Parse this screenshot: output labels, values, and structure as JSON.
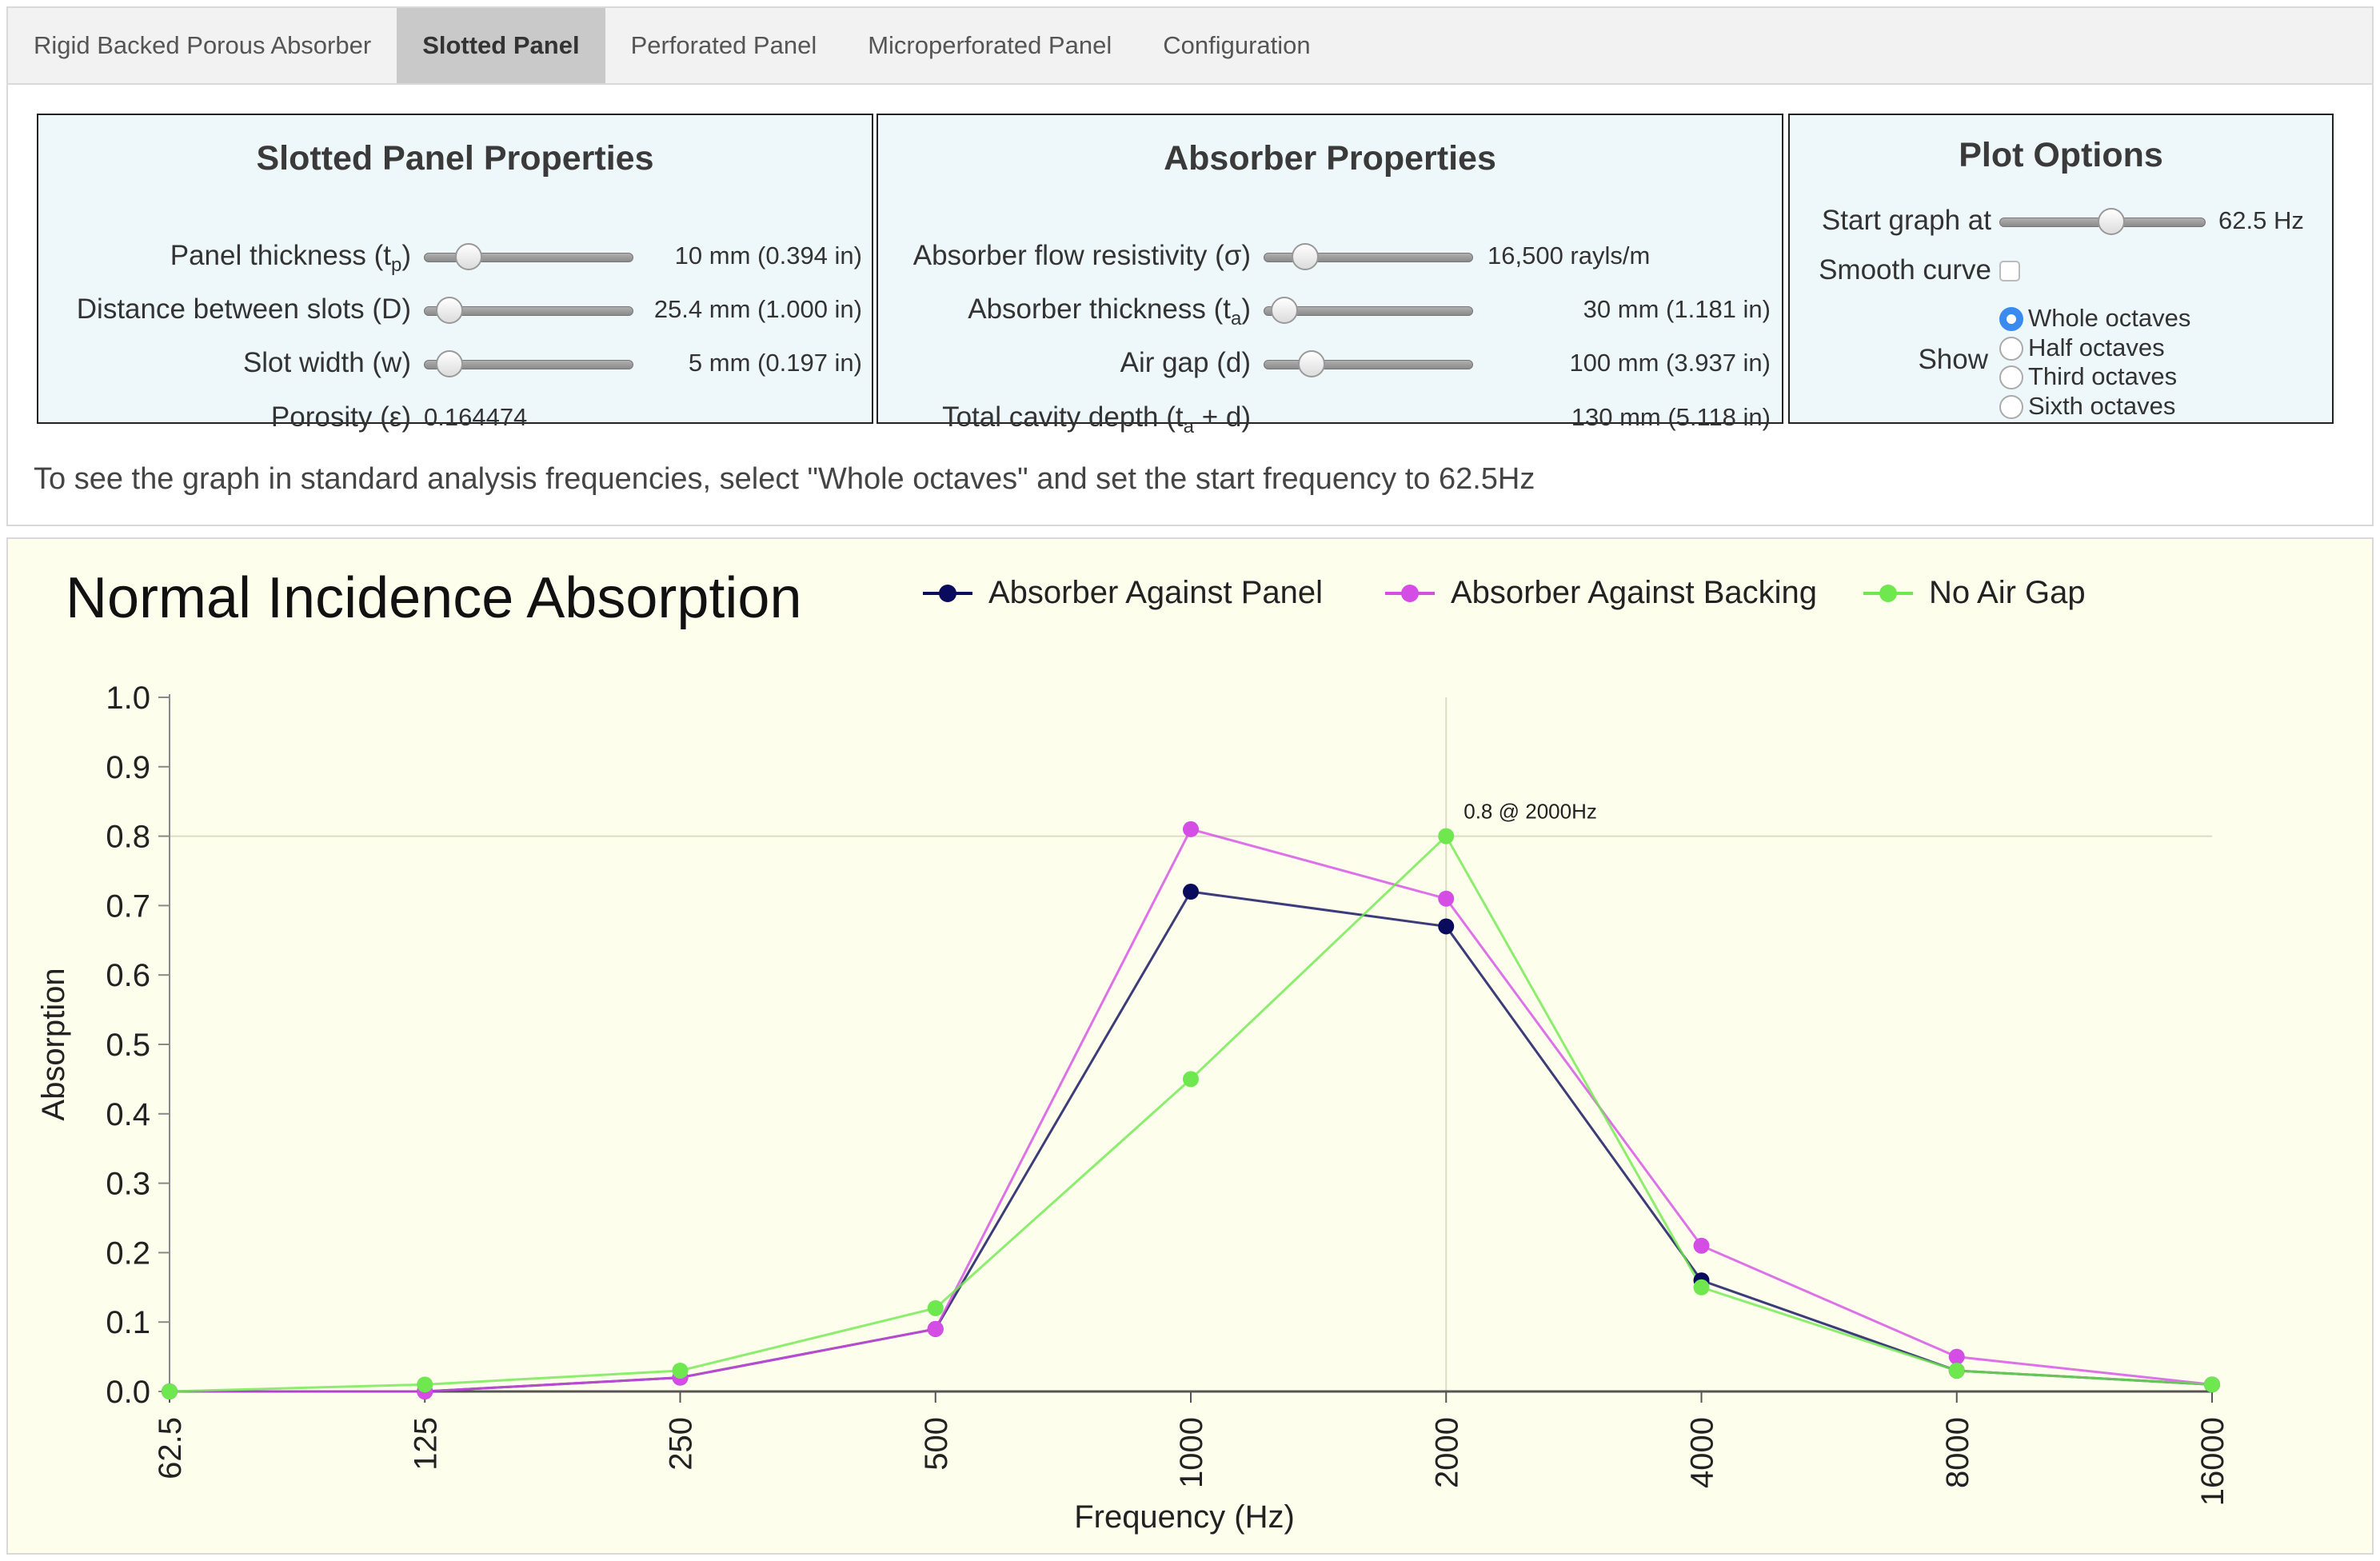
{
  "tabs": [
    {
      "label": "Rigid Backed Porous Absorber",
      "active": false
    },
    {
      "label": "Slotted Panel",
      "active": true
    },
    {
      "label": "Perforated Panel",
      "active": false
    },
    {
      "label": "Microperforated Panel",
      "active": false
    },
    {
      "label": "Configuration",
      "active": false
    }
  ],
  "slotted": {
    "title": "Slotted Panel Properties",
    "thickness_label": "Panel thickness (t",
    "thickness_sub": "p",
    "thickness_label_end": ")",
    "thickness_value": "10 mm  (0.394 in)",
    "distance_label": "Distance between slots (D)",
    "distance_value": "25.4 mm  (1.000 in)",
    "width_label": "Slot width (w)",
    "width_value": "5 mm  (0.197 in)",
    "porosity_label": "Porosity (ε)",
    "porosity_value": "0.164474"
  },
  "absorber": {
    "title": "Absorber Properties",
    "flow_label": "Absorber flow resistivity (σ)",
    "flow_value": "16,500 rayls/m",
    "thickness_label": "Absorber thickness (t",
    "thickness_sub": "a",
    "thickness_label_end": ")",
    "thickness_value": "30 mm  (1.181 in)",
    "airgap_label": "Air gap (d)",
    "airgap_value": "100 mm  (3.937 in)",
    "cavity_label": "Total cavity depth (t",
    "cavity_sub": "a",
    "cavity_label_end": " + d)",
    "cavity_value": "130 mm  (5.118 in)"
  },
  "plot_options": {
    "title": "Plot Options",
    "start_label": "Start graph at",
    "start_value": "62.5 Hz",
    "smooth_label": "Smooth curve",
    "show_label": "Show",
    "options": [
      "Whole octaves",
      "Half octaves",
      "Third octaves",
      "Sixth octaves"
    ],
    "selected": "Whole octaves"
  },
  "hint": "To see the graph in standard analysis frequencies, select \"Whole octaves\" and set the start frequency to 62.5Hz",
  "chart_data": {
    "type": "line",
    "title": "Normal Incidence Absorption",
    "xlabel": "Frequency (Hz)",
    "ylabel": "Absorption",
    "categories": [
      "62.5",
      "125",
      "250",
      "500",
      "1000",
      "2000",
      "4000",
      "8000",
      "16000"
    ],
    "ylim": [
      0,
      1
    ],
    "yticks": [
      "0.0",
      "0.1",
      "0.2",
      "0.3",
      "0.4",
      "0.5",
      "0.6",
      "0.7",
      "0.8",
      "0.9",
      "1.0"
    ],
    "grid": false,
    "legend_position": "top",
    "series": [
      {
        "name": "Absorber Against Panel",
        "color": "#0b0b5e",
        "values": [
          0.0,
          0.0,
          0.02,
          0.09,
          0.72,
          0.67,
          0.16,
          0.03,
          0.01
        ]
      },
      {
        "name": "Absorber Against Backing",
        "color": "#d44ee6",
        "values": [
          0.0,
          0.0,
          0.02,
          0.09,
          0.81,
          0.71,
          0.21,
          0.05,
          0.01
        ]
      },
      {
        "name": "No Air Gap",
        "color": "#6fe84f",
        "values": [
          0.0,
          0.01,
          0.03,
          0.12,
          0.45,
          0.8,
          0.15,
          0.03,
          0.01
        ]
      }
    ],
    "annotation": "0.8 @ 2000Hz",
    "annotation_point": {
      "series": "No Air Gap",
      "category": "2000",
      "value": 0.8
    }
  },
  "colors": {
    "panel_bg": "#eef8fb",
    "chart_bg": "#fefeec",
    "radio_accent": "#3b8af0"
  }
}
